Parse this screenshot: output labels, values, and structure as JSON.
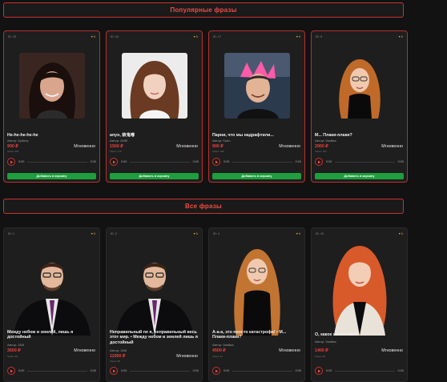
{
  "sections": {
    "popular_title": "Популярные фразы",
    "all_title": "Все фразы"
  },
  "labels": {
    "author_prefix": "Автор: ",
    "views_prefix": "Views: ",
    "add_to_cart": "Добавить в корзину",
    "time_start": "0:00",
    "time_end": "0:00",
    "delivery": "Мгновенно"
  },
  "popular": [
    {
      "id": "ID: 23",
      "fav": "♥ 6",
      "title": "He-he-he-he-he",
      "author": "Автор: Sydney",
      "price": "900 ₽",
      "views": "Views: 301"
    },
    {
      "id": "ID: 24",
      "fav": "♥ 6",
      "title": "anyo, 娘鬼嘟",
      "author": "Автор: ANIE",
      "price": "1500 ₽",
      "views": "Views: 176"
    },
    {
      "id": "ID: 17",
      "fav": "♥ 6",
      "title": "Парни, что мы надрафтили...",
      "author": "Автор: Sodo",
      "price": "900 ₽",
      "views": "Views: 158"
    },
    {
      "id": "ID: 5",
      "fav": "♥ 6",
      "title": "М... Плаки-плаки?",
      "author": "Автор: Vasilisa",
      "price": "2000 ₽",
      "views": "Views: 152"
    }
  ],
  "all": [
    {
      "id": "ID: 1",
      "fav": "♥ 6",
      "title": "Между небом и землей, лишь я достойный",
      "author": "Автор: JAM",
      "price": "3500 ₽",
      "views": "Views: 95"
    },
    {
      "id": "ID: 2",
      "fav": "♥ 6",
      "title": "Неправильный ne я, неправильный весь этот мир. • Между небом и землей лишь я достойный",
      "author": "Автор: JAM",
      "price": "11000 ₽",
      "views": "Views: 80"
    },
    {
      "id": "ID: 4",
      "fav": "♥ 6",
      "title": "А-а-а, это просто катастрофа! • М... Плаки-плаки?",
      "author": "Автор: Vasilisa",
      "price": "4500 ₽",
      "views": "Views: 41"
    },
    {
      "id": "ID: 10",
      "fav": "♥ 6",
      "title": "О, какое же это мясо",
      "author": "Автор: Vasilisa",
      "price": "1400 ₽",
      "views": "Views: 39"
    }
  ],
  "colors": {
    "accent": "#ef4d44",
    "price": "#ef4040",
    "cart": "#1e9e3e",
    "background": "#121212",
    "card": "#1e1e1e"
  }
}
